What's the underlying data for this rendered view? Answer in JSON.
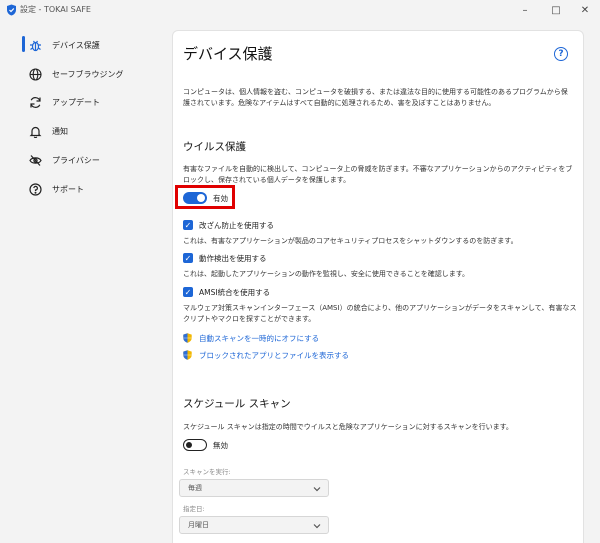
{
  "window": {
    "title": "設定 - TOKAI SAFE",
    "minimize_glyph": "–",
    "maximize_glyph": "□",
    "close_glyph": "✕"
  },
  "sidebar": {
    "items": [
      {
        "label": "デバイス保護",
        "icon": "bug-icon",
        "active": true
      },
      {
        "label": "セーフブラウジング",
        "icon": "globe-icon",
        "active": false
      },
      {
        "label": "アップデート",
        "icon": "refresh-icon",
        "active": false
      },
      {
        "label": "通知",
        "icon": "bell-icon",
        "active": false
      },
      {
        "label": "プライバシー",
        "icon": "eye-off-icon",
        "active": false
      },
      {
        "label": "サポート",
        "icon": "question-circle-icon",
        "active": false
      }
    ]
  },
  "main": {
    "title": "デバイス保護",
    "help_glyph": "?",
    "intro": "コンピュータは、個人情報を盗む、コンピュータを破損する、または違法な目的に使用する可能性のあるプログラムから保護されています。危険なアイテムはすべて自動的に処理されるため、害を及ぼすことはありません。",
    "virus": {
      "title": "ウイルス保護",
      "description": "有害なファイルを自動的に検出して、コンピュータ上の脅威を防ぎます。不審なアプリケーションからのアクティビティをブロックし、保存されている個人データを保護します。",
      "toggle_label": "有効",
      "toggle_on": true,
      "options": [
        {
          "label": "改ざん防止を使用する",
          "checked": true,
          "description": "これは、有害なアプリケーションが製品のコアセキュリティプロセスをシャットダウンするのを防ぎます。"
        },
        {
          "label": "動作検出を使用する",
          "checked": true,
          "description": "これは、起動したアプリケーションの動作を監視し、安全に使用できることを確認します。"
        },
        {
          "label": "AMSI統合を使用する",
          "checked": true,
          "description": "マルウェア対策スキャンインターフェース（AMSI）の統合により、他のアプリケーションがデータをスキャンして、有害なスクリプトやマクロを探すことができます。"
        }
      ],
      "links": [
        {
          "label": "自動スキャンを一時的にオフにする",
          "icon": "uac-shield-icon"
        },
        {
          "label": "ブロックされたアプリとファイルを表示する",
          "icon": "uac-shield-icon"
        }
      ]
    },
    "schedule": {
      "title": "スケジュール スキャン",
      "description": "スケジュール スキャンは指定の時間でウイルスと危険なアプリケーションに対するスキャンを行います。",
      "toggle_label": "無効",
      "toggle_on": false,
      "run_label": "スキャンを実行:",
      "run_value": "毎週",
      "day_label": "指定日:",
      "day_value": "月曜日"
    }
  },
  "colors": {
    "accent": "#1d66d6",
    "highlight": "#e00000"
  }
}
